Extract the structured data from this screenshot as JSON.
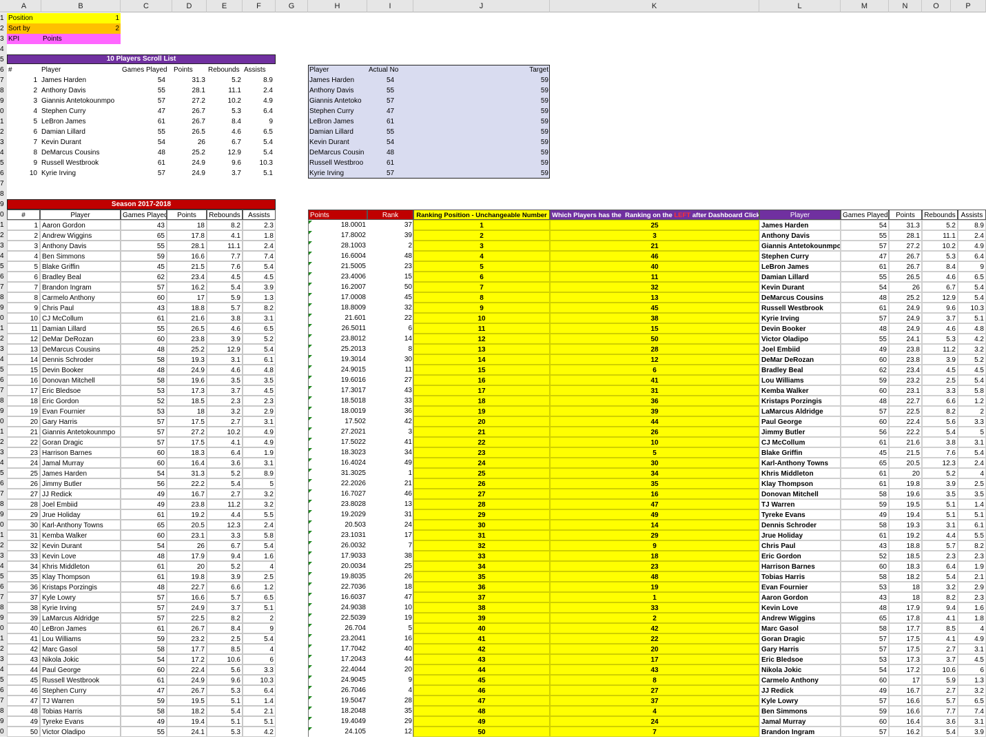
{
  "colors": {
    "yellow": "#ffff00",
    "orange": "#f4b183",
    "pink": "#ff66ff",
    "purple": "#7030a0",
    "red": "#c00000",
    "lavender": "#d9dcf0",
    "green_flag": "#1e8a1e"
  },
  "columns": [
    "A",
    "B",
    "C",
    "D",
    "E",
    "F",
    "G",
    "H",
    "I",
    "J",
    "K",
    "L",
    "M",
    "N",
    "O",
    "P"
  ],
  "rows": [
    "1",
    "2",
    "3",
    "4",
    "5",
    "6",
    "7",
    "8",
    "9",
    "0",
    "1",
    "2",
    "3",
    "4",
    "5",
    "6",
    "7",
    "8",
    "9",
    "0",
    "1",
    "2",
    "3",
    "4",
    "5",
    "6",
    "7",
    "8",
    "9",
    "0",
    "1",
    "2",
    "3",
    "4",
    "5",
    "6",
    "7",
    "8",
    "9",
    "0",
    "1",
    "2",
    "3",
    "4",
    "5",
    "6",
    "7",
    "8",
    "9",
    "0",
    "1",
    "2",
    "3",
    "4",
    "5",
    "6",
    "7",
    "8",
    "9",
    "0",
    "1",
    "2",
    "3",
    "4",
    "5",
    "6",
    "7",
    "8",
    "9",
    "0"
  ],
  "controls": {
    "position_label": "Position",
    "position_value": "1",
    "sortby_label": "Sort by",
    "sortby_value": "2",
    "kpi_label": "KPI",
    "kpi_value": "Points"
  },
  "top10": {
    "title": "10 Players Scroll List",
    "headers": [
      "#",
      "Player",
      "Games Played",
      "Points",
      "Rebounds",
      "Assists"
    ],
    "rows": [
      [
        "1",
        "James Harden",
        "54",
        "31.3",
        "5.2",
        "8.9"
      ],
      [
        "2",
        "Anthony Davis",
        "55",
        "28.1",
        "11.1",
        "2.4"
      ],
      [
        "3",
        "Giannis Antetokounmpo",
        "57",
        "27.2",
        "10.2",
        "4.9"
      ],
      [
        "4",
        "Stephen Curry",
        "47",
        "26.7",
        "5.3",
        "6.4"
      ],
      [
        "5",
        "LeBron James",
        "61",
        "26.7",
        "8.4",
        "9"
      ],
      [
        "6",
        "Damian Lillard",
        "55",
        "26.5",
        "4.6",
        "6.5"
      ],
      [
        "7",
        "Kevin Durant",
        "54",
        "26",
        "6.7",
        "5.4"
      ],
      [
        "8",
        "DeMarcus Cousins",
        "48",
        "25.2",
        "12.9",
        "5.4"
      ],
      [
        "9",
        "Russell Westbrook",
        "61",
        "24.9",
        "9.6",
        "10.3"
      ],
      [
        "10",
        "Kyrie Irving",
        "57",
        "24.9",
        "3.7",
        "5.1"
      ]
    ]
  },
  "target": {
    "headers": [
      "Player",
      "Actual No",
      "Target"
    ],
    "rows": [
      [
        "James Harden",
        "54",
        "59"
      ],
      [
        "Anthony Davis",
        "55",
        "59"
      ],
      [
        "Giannis Antetoko",
        "57",
        "59"
      ],
      [
        "Stephen Curry",
        "47",
        "59"
      ],
      [
        "LeBron James",
        "61",
        "59"
      ],
      [
        "Damian Lillard",
        "55",
        "59"
      ],
      [
        "Kevin Durant",
        "54",
        "59"
      ],
      [
        "DeMarcus Cousin",
        "48",
        "59"
      ],
      [
        "Russell Westbroo",
        "61",
        "59"
      ],
      [
        "Kyrie Irving",
        "57",
        "59"
      ]
    ]
  },
  "season": {
    "title": "Season 2017-2018",
    "headers": [
      "#",
      "Player",
      "Games Played",
      "Points",
      "Rebounds",
      "Assists"
    ],
    "rows": [
      [
        "1",
        "Aaron Gordon",
        "43",
        "18",
        "8.2",
        "2.3"
      ],
      [
        "2",
        "Andrew Wiggins",
        "65",
        "17.8",
        "4.1",
        "1.8"
      ],
      [
        "3",
        "Anthony Davis",
        "55",
        "28.1",
        "11.1",
        "2.4"
      ],
      [
        "4",
        "Ben Simmons",
        "59",
        "16.6",
        "7.7",
        "7.4"
      ],
      [
        "5",
        "Blake Griffin",
        "45",
        "21.5",
        "7.6",
        "5.4"
      ],
      [
        "6",
        "Bradley Beal",
        "62",
        "23.4",
        "4.5",
        "4.5"
      ],
      [
        "7",
        "Brandon Ingram",
        "57",
        "16.2",
        "5.4",
        "3.9"
      ],
      [
        "8",
        "Carmelo Anthony",
        "60",
        "17",
        "5.9",
        "1.3"
      ],
      [
        "9",
        "Chris Paul",
        "43",
        "18.8",
        "5.7",
        "8.2"
      ],
      [
        "10",
        "CJ McCollum",
        "61",
        "21.6",
        "3.8",
        "3.1"
      ],
      [
        "11",
        "Damian Lillard",
        "55",
        "26.5",
        "4.6",
        "6.5"
      ],
      [
        "12",
        "DeMar DeRozan",
        "60",
        "23.8",
        "3.9",
        "5.2"
      ],
      [
        "13",
        "DeMarcus Cousins",
        "48",
        "25.2",
        "12.9",
        "5.4"
      ],
      [
        "14",
        "Dennis Schroder",
        "58",
        "19.3",
        "3.1",
        "6.1"
      ],
      [
        "15",
        "Devin Booker",
        "48",
        "24.9",
        "4.6",
        "4.8"
      ],
      [
        "16",
        "Donovan Mitchell",
        "58",
        "19.6",
        "3.5",
        "3.5"
      ],
      [
        "17",
        "Eric Bledsoe",
        "53",
        "17.3",
        "3.7",
        "4.5"
      ],
      [
        "18",
        "Eric Gordon",
        "52",
        "18.5",
        "2.3",
        "2.3"
      ],
      [
        "19",
        "Evan Fournier",
        "53",
        "18",
        "3.2",
        "2.9"
      ],
      [
        "20",
        "Gary Harris",
        "57",
        "17.5",
        "2.7",
        "3.1"
      ],
      [
        "21",
        "Giannis Antetokounmpo",
        "57",
        "27.2",
        "10.2",
        "4.9"
      ],
      [
        "22",
        "Goran Dragic",
        "57",
        "17.5",
        "4.1",
        "4.9"
      ],
      [
        "23",
        "Harrison Barnes",
        "60",
        "18.3",
        "6.4",
        "1.9"
      ],
      [
        "24",
        "Jamal Murray",
        "60",
        "16.4",
        "3.6",
        "3.1"
      ],
      [
        "25",
        "James Harden",
        "54",
        "31.3",
        "5.2",
        "8.9"
      ],
      [
        "26",
        "Jimmy Butler",
        "56",
        "22.2",
        "5.4",
        "5"
      ],
      [
        "27",
        "JJ Redick",
        "49",
        "16.7",
        "2.7",
        "3.2"
      ],
      [
        "28",
        "Joel Embiid",
        "49",
        "23.8",
        "11.2",
        "3.2"
      ],
      [
        "29",
        "Jrue Holiday",
        "61",
        "19.2",
        "4.4",
        "5.5"
      ],
      [
        "30",
        "Karl-Anthony Towns",
        "65",
        "20.5",
        "12.3",
        "2.4"
      ],
      [
        "31",
        "Kemba Walker",
        "60",
        "23.1",
        "3.3",
        "5.8"
      ],
      [
        "32",
        "Kevin Durant",
        "54",
        "26",
        "6.7",
        "5.4"
      ],
      [
        "33",
        "Kevin Love",
        "48",
        "17.9",
        "9.4",
        "1.6"
      ],
      [
        "34",
        "Khris Middleton",
        "61",
        "20",
        "5.2",
        "4"
      ],
      [
        "35",
        "Klay Thompson",
        "61",
        "19.8",
        "3.9",
        "2.5"
      ],
      [
        "36",
        "Kristaps Porzingis",
        "48",
        "22.7",
        "6.6",
        "1.2"
      ],
      [
        "37",
        "Kyle Lowry",
        "57",
        "16.6",
        "5.7",
        "6.5"
      ],
      [
        "38",
        "Kyrie Irving",
        "57",
        "24.9",
        "3.7",
        "5.1"
      ],
      [
        "39",
        "LaMarcus Aldridge",
        "57",
        "22.5",
        "8.2",
        "2"
      ],
      [
        "40",
        "LeBron James",
        "61",
        "26.7",
        "8.4",
        "9"
      ],
      [
        "41",
        "Lou Williams",
        "59",
        "23.2",
        "2.5",
        "5.4"
      ],
      [
        "42",
        "Marc Gasol",
        "58",
        "17.7",
        "8.5",
        "4"
      ],
      [
        "43",
        "Nikola Jokic",
        "54",
        "17.2",
        "10.6",
        "6"
      ],
      [
        "44",
        "Paul George",
        "60",
        "22.4",
        "5.6",
        "3.3"
      ],
      [
        "45",
        "Russell Westbrook",
        "61",
        "24.9",
        "9.6",
        "10.3"
      ],
      [
        "46",
        "Stephen Curry",
        "47",
        "26.7",
        "5.3",
        "6.4"
      ],
      [
        "47",
        "TJ Warren",
        "59",
        "19.5",
        "5.1",
        "1.4"
      ],
      [
        "48",
        "Tobias Harris",
        "58",
        "18.2",
        "5.4",
        "2.1"
      ],
      [
        "49",
        "Tyreke Evans",
        "49",
        "19.4",
        "5.1",
        "5.1"
      ],
      [
        "50",
        "Victor Oladipo",
        "55",
        "24.1",
        "5.3",
        "4.2"
      ]
    ]
  },
  "rank": {
    "headers": {
      "points": "Points",
      "rank": "Rank",
      "position": "Ranking Position - Unchangeable Number",
      "which_a": "Which Players has the  Ranking on the ",
      "which_red": "LEFT",
      "which_b": " after Dashboard Click",
      "player": "Player",
      "gp": "Games Played",
      "pts": "Points",
      "reb": "Rebounds",
      "ast": "Assists"
    },
    "rows": [
      [
        "18.0001",
        "37",
        "1",
        "25",
        "James Harden",
        "54",
        "31.3",
        "5.2",
        "8.9"
      ],
      [
        "17.8002",
        "39",
        "2",
        "3",
        "Anthony Davis",
        "55",
        "28.1",
        "11.1",
        "2.4"
      ],
      [
        "28.1003",
        "2",
        "3",
        "21",
        "Giannis Antetokounmpo",
        "57",
        "27.2",
        "10.2",
        "4.9"
      ],
      [
        "16.6004",
        "48",
        "4",
        "46",
        "Stephen Curry",
        "47",
        "26.7",
        "5.3",
        "6.4"
      ],
      [
        "21.5005",
        "23",
        "5",
        "40",
        "LeBron James",
        "61",
        "26.7",
        "8.4",
        "9"
      ],
      [
        "23.4006",
        "15",
        "6",
        "11",
        "Damian Lillard",
        "55",
        "26.5",
        "4.6",
        "6.5"
      ],
      [
        "16.2007",
        "50",
        "7",
        "32",
        "Kevin Durant",
        "54",
        "26",
        "6.7",
        "5.4"
      ],
      [
        "17.0008",
        "45",
        "8",
        "13",
        "DeMarcus Cousins",
        "48",
        "25.2",
        "12.9",
        "5.4"
      ],
      [
        "18.8009",
        "32",
        "9",
        "45",
        "Russell Westbrook",
        "61",
        "24.9",
        "9.6",
        "10.3"
      ],
      [
        "21.601",
        "22",
        "10",
        "38",
        "Kyrie Irving",
        "57",
        "24.9",
        "3.7",
        "5.1"
      ],
      [
        "26.5011",
        "6",
        "11",
        "15",
        "Devin Booker",
        "48",
        "24.9",
        "4.6",
        "4.8"
      ],
      [
        "23.8012",
        "14",
        "12",
        "50",
        "Victor Oladipo",
        "55",
        "24.1",
        "5.3",
        "4.2"
      ],
      [
        "25.2013",
        "8",
        "13",
        "28",
        "Joel Embiid",
        "49",
        "23.8",
        "11.2",
        "3.2"
      ],
      [
        "19.3014",
        "30",
        "14",
        "12",
        "DeMar DeRozan",
        "60",
        "23.8",
        "3.9",
        "5.2"
      ],
      [
        "24.9015",
        "11",
        "15",
        "6",
        "Bradley Beal",
        "62",
        "23.4",
        "4.5",
        "4.5"
      ],
      [
        "19.6016",
        "27",
        "16",
        "41",
        "Lou Williams",
        "59",
        "23.2",
        "2.5",
        "5.4"
      ],
      [
        "17.3017",
        "43",
        "17",
        "31",
        "Kemba Walker",
        "60",
        "23.1",
        "3.3",
        "5.8"
      ],
      [
        "18.5018",
        "33",
        "18",
        "36",
        "Kristaps Porzingis",
        "48",
        "22.7",
        "6.6",
        "1.2"
      ],
      [
        "18.0019",
        "36",
        "19",
        "39",
        "LaMarcus Aldridge",
        "57",
        "22.5",
        "8.2",
        "2"
      ],
      [
        "17.502",
        "42",
        "20",
        "44",
        "Paul George",
        "60",
        "22.4",
        "5.6",
        "3.3"
      ],
      [
        "27.2021",
        "3",
        "21",
        "26",
        "Jimmy Butler",
        "56",
        "22.2",
        "5.4",
        "5"
      ],
      [
        "17.5022",
        "41",
        "22",
        "10",
        "CJ McCollum",
        "61",
        "21.6",
        "3.8",
        "3.1"
      ],
      [
        "18.3023",
        "34",
        "23",
        "5",
        "Blake Griffin",
        "45",
        "21.5",
        "7.6",
        "5.4"
      ],
      [
        "16.4024",
        "49",
        "24",
        "30",
        "Karl-Anthony Towns",
        "65",
        "20.5",
        "12.3",
        "2.4"
      ],
      [
        "31.3025",
        "1",
        "25",
        "34",
        "Khris Middleton",
        "61",
        "20",
        "5.2",
        "4"
      ],
      [
        "22.2026",
        "21",
        "26",
        "35",
        "Klay Thompson",
        "61",
        "19.8",
        "3.9",
        "2.5"
      ],
      [
        "16.7027",
        "46",
        "27",
        "16",
        "Donovan Mitchell",
        "58",
        "19.6",
        "3.5",
        "3.5"
      ],
      [
        "23.8028",
        "13",
        "28",
        "47",
        "TJ Warren",
        "59",
        "19.5",
        "5.1",
        "1.4"
      ],
      [
        "19.2029",
        "31",
        "29",
        "49",
        "Tyreke Evans",
        "49",
        "19.4",
        "5.1",
        "5.1"
      ],
      [
        "20.503",
        "24",
        "30",
        "14",
        "Dennis Schroder",
        "58",
        "19.3",
        "3.1",
        "6.1"
      ],
      [
        "23.1031",
        "17",
        "31",
        "29",
        "Jrue Holiday",
        "61",
        "19.2",
        "4.4",
        "5.5"
      ],
      [
        "26.0032",
        "7",
        "32",
        "9",
        "Chris Paul",
        "43",
        "18.8",
        "5.7",
        "8.2"
      ],
      [
        "17.9033",
        "38",
        "33",
        "18",
        "Eric Gordon",
        "52",
        "18.5",
        "2.3",
        "2.3"
      ],
      [
        "20.0034",
        "25",
        "34",
        "23",
        "Harrison Barnes",
        "60",
        "18.3",
        "6.4",
        "1.9"
      ],
      [
        "19.8035",
        "26",
        "35",
        "48",
        "Tobias Harris",
        "58",
        "18.2",
        "5.4",
        "2.1"
      ],
      [
        "22.7036",
        "18",
        "36",
        "19",
        "Evan Fournier",
        "53",
        "18",
        "3.2",
        "2.9"
      ],
      [
        "16.6037",
        "47",
        "37",
        "1",
        "Aaron Gordon",
        "43",
        "18",
        "8.2",
        "2.3"
      ],
      [
        "24.9038",
        "10",
        "38",
        "33",
        "Kevin Love",
        "48",
        "17.9",
        "9.4",
        "1.6"
      ],
      [
        "22.5039",
        "19",
        "39",
        "2",
        "Andrew Wiggins",
        "65",
        "17.8",
        "4.1",
        "1.8"
      ],
      [
        "26.704",
        "5",
        "40",
        "42",
        "Marc Gasol",
        "58",
        "17.7",
        "8.5",
        "4"
      ],
      [
        "23.2041",
        "16",
        "41",
        "22",
        "Goran Dragic",
        "57",
        "17.5",
        "4.1",
        "4.9"
      ],
      [
        "17.7042",
        "40",
        "42",
        "20",
        "Gary Harris",
        "57",
        "17.5",
        "2.7",
        "3.1"
      ],
      [
        "17.2043",
        "44",
        "43",
        "17",
        "Eric Bledsoe",
        "53",
        "17.3",
        "3.7",
        "4.5"
      ],
      [
        "22.4044",
        "20",
        "44",
        "43",
        "Nikola Jokic",
        "54",
        "17.2",
        "10.6",
        "6"
      ],
      [
        "24.9045",
        "9",
        "45",
        "8",
        "Carmelo Anthony",
        "60",
        "17",
        "5.9",
        "1.3"
      ],
      [
        "26.7046",
        "4",
        "46",
        "27",
        "JJ Redick",
        "49",
        "16.7",
        "2.7",
        "3.2"
      ],
      [
        "19.5047",
        "28",
        "47",
        "37",
        "Kyle Lowry",
        "57",
        "16.6",
        "5.7",
        "6.5"
      ],
      [
        "18.2048",
        "35",
        "48",
        "4",
        "Ben Simmons",
        "59",
        "16.6",
        "7.7",
        "7.4"
      ],
      [
        "19.4049",
        "29",
        "49",
        "24",
        "Jamal Murray",
        "60",
        "16.4",
        "3.6",
        "3.1"
      ],
      [
        "24.105",
        "12",
        "50",
        "7",
        "Brandon Ingram",
        "57",
        "16.2",
        "5.4",
        "3.9"
      ]
    ]
  }
}
